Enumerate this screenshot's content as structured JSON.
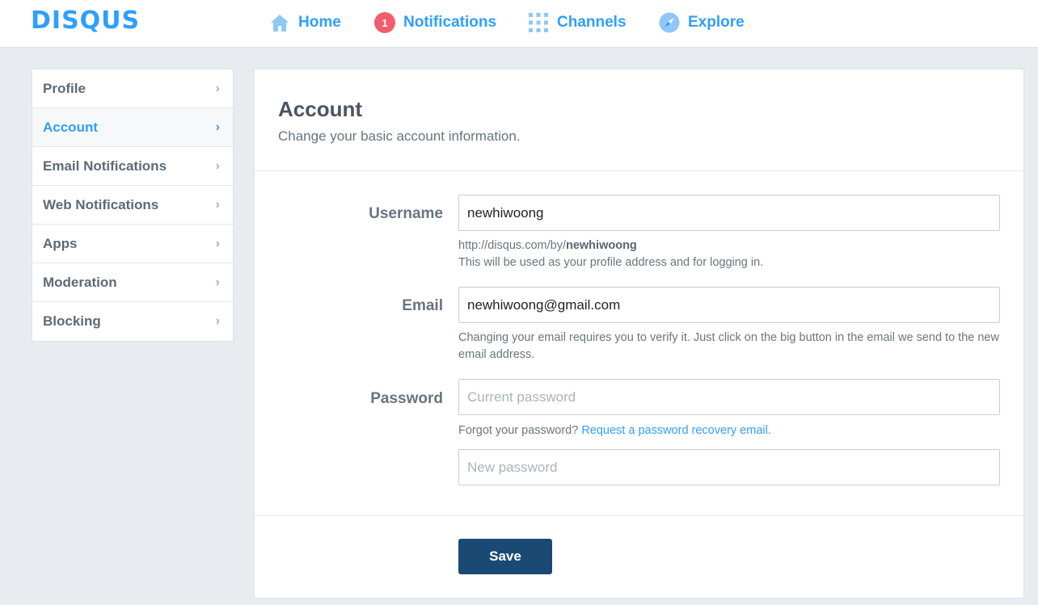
{
  "brand": {
    "logo_text": "DISQUS",
    "color": "#2e9fff"
  },
  "topnav": {
    "home_label": "Home",
    "notifications_label": "Notifications",
    "notifications_count": "1",
    "channels_label": "Channels",
    "explore_label": "Explore"
  },
  "sidebar": {
    "items": [
      {
        "label": "Profile",
        "active": false
      },
      {
        "label": "Account",
        "active": true
      },
      {
        "label": "Email Notifications",
        "active": false
      },
      {
        "label": "Web Notifications",
        "active": false
      },
      {
        "label": "Apps",
        "active": false
      },
      {
        "label": "Moderation",
        "active": false
      },
      {
        "label": "Blocking",
        "active": false
      }
    ]
  },
  "account": {
    "title": "Account",
    "subtitle": "Change your basic account information.",
    "username": {
      "label": "Username",
      "value": "newhiwoong",
      "profile_url_prefix": "http://disqus.com/by/",
      "profile_url_user": "newhiwoong",
      "help": "This will be used as your profile address and for logging in."
    },
    "email": {
      "label": "Email",
      "value": "newhiwoong@gmail.com",
      "help": "Changing your email requires you to verify it. Just click on the big button in the email we send to the new email address."
    },
    "password": {
      "label": "Password",
      "current_placeholder": "Current password",
      "forgot_text": "Forgot your password?",
      "recovery_link": "Request a password recovery email.",
      "new_placeholder": "New password"
    },
    "save_label": "Save"
  }
}
